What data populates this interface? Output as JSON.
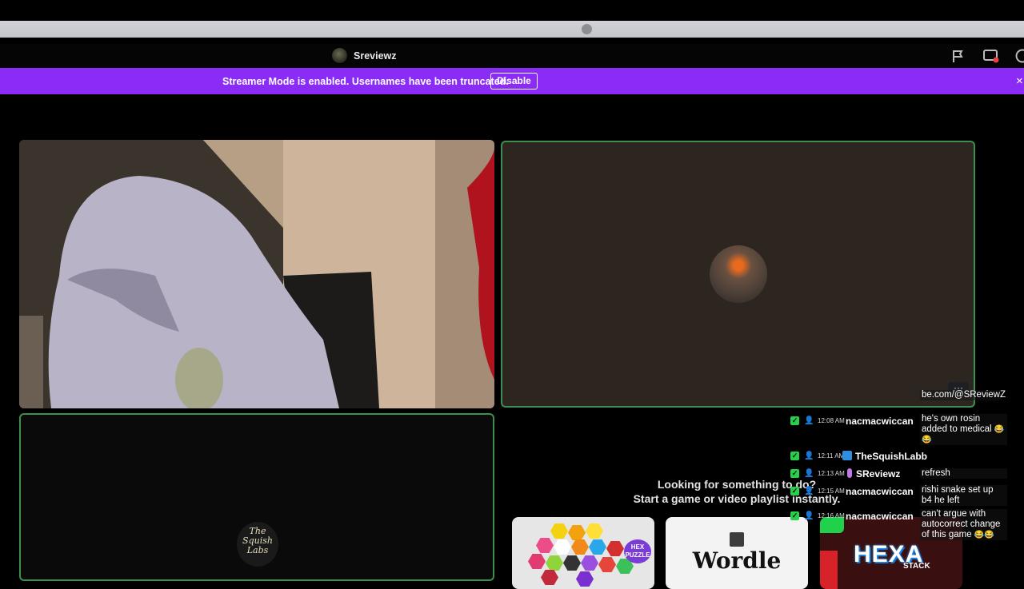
{
  "titlebar": {
    "channel_name": "Sreviewz",
    "icons": [
      "flag-icon",
      "screen-share-icon",
      "help-icon"
    ]
  },
  "banner": {
    "message": "Streamer Mode is enabled. Usernames have been truncated.",
    "button_label": "Disable",
    "close": "×"
  },
  "tiles": {
    "logo_text": "The Squish Labs"
  },
  "activity": {
    "line1": "Looking for something to do?",
    "line2": "Start a game or video playlist instantly.",
    "cards": [
      {
        "name": "Hex Puzzle",
        "badge": "HEX PUZZLE"
      },
      {
        "name": "Wordle",
        "title": "Wordle"
      },
      {
        "name": "Hexa Stack",
        "title": "HEXA",
        "subtitle": "STACK"
      }
    ]
  },
  "chat": {
    "menu": "···",
    "top_fragment": "be.com/@SReviewZ",
    "messages": [
      {
        "time": "12:08 AM",
        "user": "nacmacwiccan",
        "text": "he's own rosin added to medical",
        "emoji": "😂😂"
      },
      {
        "time": "12:11 AM",
        "user": "TheSquishLabb",
        "text": "",
        "emoji": ""
      },
      {
        "time": "12:13 AM",
        "user": "SReviewz",
        "text": "refresh",
        "emoji": ""
      },
      {
        "time": "12:15 AM",
        "user": "nacmacwiccan",
        "text": "rishi snake set up b4 he left",
        "emoji": ""
      },
      {
        "time": "12:16 AM",
        "user": "nacmacwiccan",
        "text": "can't argue with autocorrect change of this game",
        "emoji": "😂😂"
      }
    ]
  },
  "colors": {
    "banner": "#8a2cf5",
    "speaking_border": "#3c8f4e",
    "chat_ok": "#27d04a"
  }
}
